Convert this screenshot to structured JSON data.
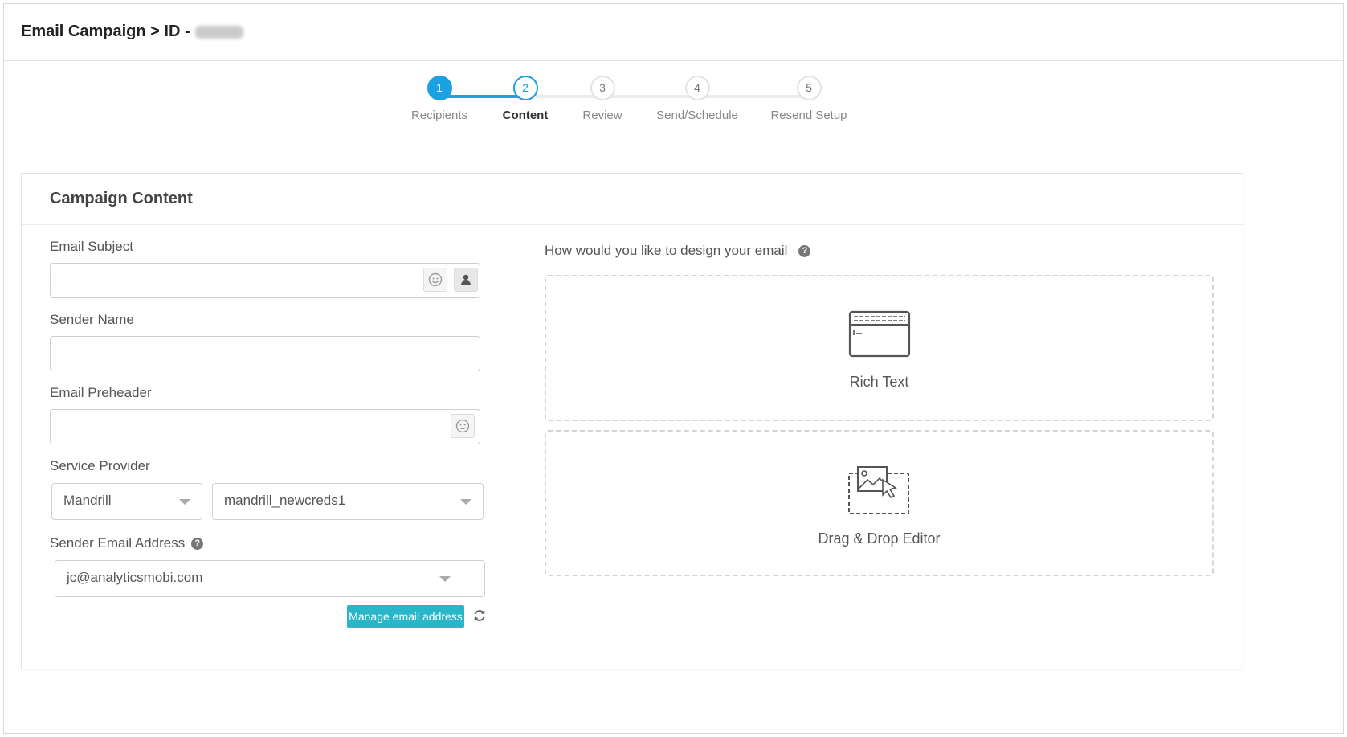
{
  "header": {
    "title": "Email Campaign > ID -"
  },
  "stepper": {
    "steps": [
      {
        "number": "1",
        "label": "Recipients"
      },
      {
        "number": "2",
        "label": "Content"
      },
      {
        "number": "3",
        "label": "Review"
      },
      {
        "number": "4",
        "label": "Send/Schedule"
      },
      {
        "number": "5",
        "label": "Resend Setup"
      }
    ],
    "current_step": 2
  },
  "card": {
    "title": "Campaign Content"
  },
  "form": {
    "email_subject": {
      "label": "Email Subject",
      "value": ""
    },
    "sender_name": {
      "label": "Sender Name",
      "value": ""
    },
    "email_preheader": {
      "label": "Email Preheader",
      "value": ""
    },
    "service_provider": {
      "label": "Service Provider",
      "provider": "Mandrill",
      "credentials": "mandrill_newcreds1"
    },
    "sender_email": {
      "label": "Sender Email Address",
      "value": "jc@analyticsmobi.com",
      "help": "?"
    },
    "manage_button": "Manage email address"
  },
  "design": {
    "question": "How would you like to design your email",
    "help": "?",
    "options": [
      {
        "label": "Rich Text",
        "icon": "rich-text-icon"
      },
      {
        "label": "Drag & Drop Editor",
        "icon": "drag-drop-editor-icon"
      }
    ]
  },
  "colors": {
    "accent": "#1aa1e2",
    "button": "#29b6c8"
  }
}
